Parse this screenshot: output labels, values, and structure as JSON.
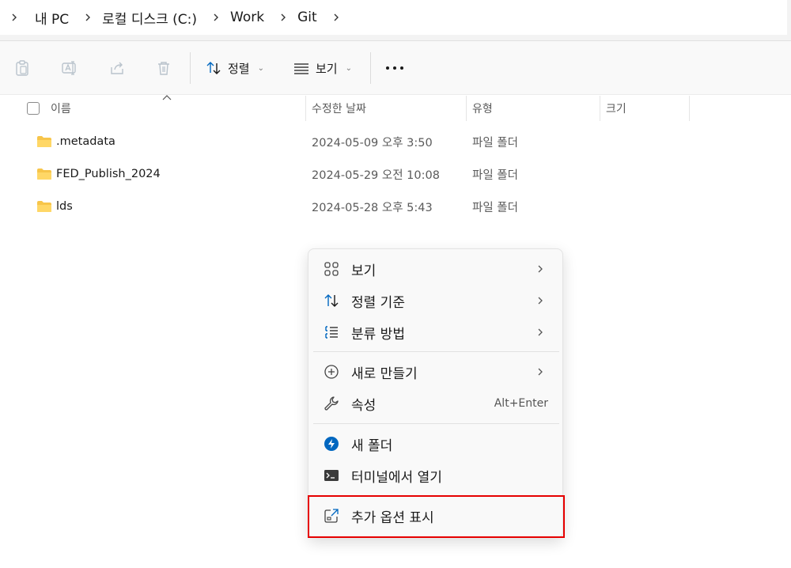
{
  "breadcrumb": {
    "items": [
      "내 PC",
      "로컬 디스크 (C:)",
      "Work",
      "Git"
    ]
  },
  "toolbar": {
    "sort_label": "정렬",
    "view_label": "보기"
  },
  "columns": {
    "name": "이름",
    "modified": "수정한 날짜",
    "type": "유형",
    "size": "크기"
  },
  "files": [
    {
      "name": ".metadata",
      "modified": "2024-05-09 오후 3:50",
      "type": "파일 폴더"
    },
    {
      "name": "FED_Publish_2024",
      "modified": "2024-05-29 오전 10:08",
      "type": "파일 폴더"
    },
    {
      "name": "lds",
      "modified": "2024-05-28 오후 5:43",
      "type": "파일 폴더"
    }
  ],
  "context_menu": {
    "view": "보기",
    "sort_by": "정렬 기준",
    "group_by": "분류 방법",
    "new": "새로 만들기",
    "properties": "속성",
    "properties_shortcut": "Alt+Enter",
    "new_folder": "새 폴더",
    "open_terminal": "터미널에서 열기",
    "show_more": "추가 옵션 표시"
  },
  "colors": {
    "accent": "#0067c0",
    "folder": "#f7c54a",
    "highlight": "#e60000"
  }
}
